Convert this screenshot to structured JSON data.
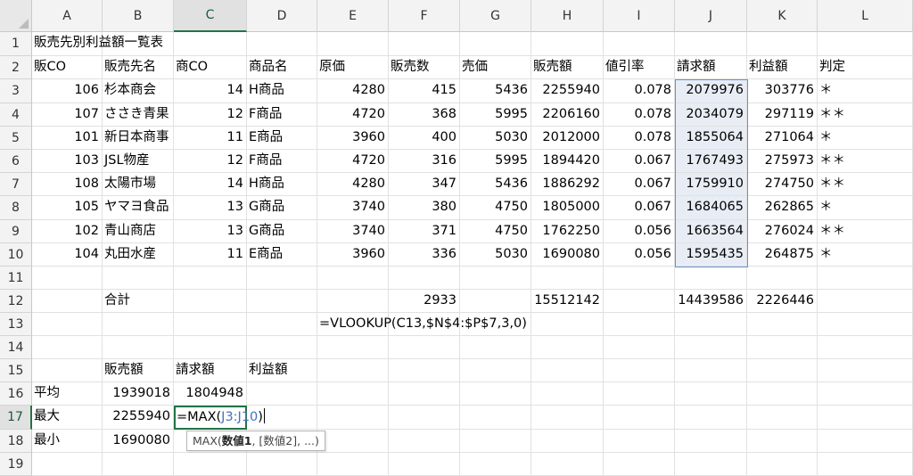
{
  "columns": [
    "A",
    "B",
    "C",
    "D",
    "E",
    "F",
    "G",
    "H",
    "I",
    "J",
    "K",
    "L"
  ],
  "rows": [
    "1",
    "2",
    "3",
    "4",
    "5",
    "6",
    "7",
    "8",
    "9",
    "10",
    "11",
    "12",
    "13",
    "14",
    "15",
    "16",
    "17",
    "18",
    "19"
  ],
  "title": "販売先別利益額一覧表",
  "headers": [
    "販CO",
    "販売先名",
    "商CO",
    "商品名",
    "原価",
    "販売数",
    "売価",
    "販売額",
    "値引率",
    "請求額",
    "利益額",
    "判定"
  ],
  "data_rows": [
    [
      "106",
      "杉本商会",
      "14",
      "H商品",
      "4280",
      "415",
      "5436",
      "2255940",
      "0.078",
      "2079976",
      "303776",
      "＊"
    ],
    [
      "107",
      "ささき青果",
      "12",
      "F商品",
      "4720",
      "368",
      "5995",
      "2206160",
      "0.078",
      "2034079",
      "297119",
      "＊＊"
    ],
    [
      "101",
      "新日本商事",
      "11",
      "E商品",
      "3960",
      "400",
      "5030",
      "2012000",
      "0.078",
      "1855064",
      "271064",
      "＊"
    ],
    [
      "103",
      "JSL物産",
      "12",
      "F商品",
      "4720",
      "316",
      "5995",
      "1894420",
      "0.067",
      "1767493",
      "275973",
      "＊＊"
    ],
    [
      "108",
      "太陽市場",
      "14",
      "H商品",
      "4280",
      "347",
      "5436",
      "1886292",
      "0.067",
      "1759910",
      "274750",
      "＊＊"
    ],
    [
      "105",
      "ヤマヨ食品",
      "13",
      "G商品",
      "3740",
      "380",
      "4750",
      "1805000",
      "0.067",
      "1684065",
      "262865",
      "＊"
    ],
    [
      "102",
      "青山商店",
      "13",
      "G商品",
      "3740",
      "371",
      "4750",
      "1762250",
      "0.056",
      "1663564",
      "276024",
      "＊＊"
    ],
    [
      "104",
      "丸田水産",
      "11",
      "E商品",
      "3960",
      "336",
      "5030",
      "1690080",
      "0.056",
      "1595435",
      "264875",
      "＊"
    ]
  ],
  "totals": {
    "label": "合計",
    "sales_qty": "2933",
    "sales_amount": "15512142",
    "billing": "14439586",
    "profit": "2226446"
  },
  "formula_row13": "=VLOOKUP(C13,$N$4:$P$7,3,0)",
  "summary": {
    "headers": [
      "販売額",
      "請求額",
      "利益額"
    ],
    "avg_label": "平均",
    "avg_sales": "1939018",
    "avg_billing": "1804948",
    "max_label": "最大",
    "max_sales": "2255940",
    "min_label": "最小",
    "min_sales": "1690080"
  },
  "editing": {
    "prefix": "=MAX(",
    "ref": "J3:J10",
    "suffix": ")"
  },
  "tooltip": {
    "fn": "MAX(",
    "arg1": "数値1",
    "rest": ", [数値2], ...)"
  }
}
